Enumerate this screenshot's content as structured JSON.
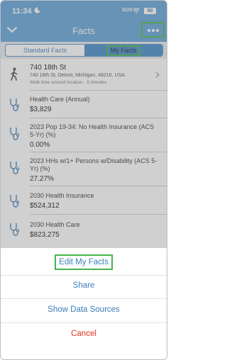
{
  "status": {
    "time": "11:34",
    "sos": "SOS",
    "battery": "90"
  },
  "nav": {
    "title": "Facts"
  },
  "segments": {
    "standard": "Standard Facts",
    "my": "My Facts"
  },
  "location": {
    "name": "740 18th St",
    "address": "740 18th St, Detroit, Michigan, 48216, USA",
    "walk": "Walk time around location - 5 minutes"
  },
  "facts": [
    {
      "title": "Health Care (Annual)",
      "value": "$3,829"
    },
    {
      "title": "2023 Pop 19-34: No Health Insurance (ACS 5-Yr) (%)",
      "value": "0.00%"
    },
    {
      "title": "2023 HHs w/1+ Persons w/Disability (ACS 5-Yr) (%)",
      "value": "27.27%"
    },
    {
      "title": "2030 Health Insurance",
      "value": "$524,312"
    },
    {
      "title": "2030 Health Care",
      "value": "$823,275"
    }
  ],
  "sheet": {
    "edit": "Edit My Facts",
    "share": "Share",
    "sources": "Show Data Sources",
    "cancel": "Cancel"
  },
  "colors": {
    "accent": "#3d7fb8",
    "highlight": "#43b54a",
    "cancel": "#e0301e"
  }
}
